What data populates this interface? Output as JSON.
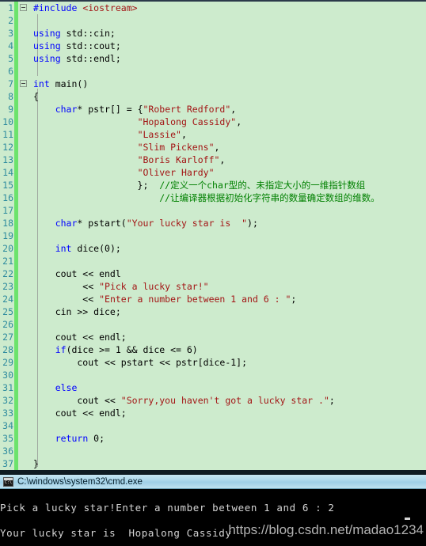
{
  "editor": {
    "name": "code-editor",
    "background_color": "#cdebcd",
    "gutter_strip_color": "#6ce36c",
    "lineno_color": "#2e8b9e",
    "colors": {
      "keyword": "#0000ff",
      "string": "#a31515",
      "comment": "#008000",
      "plain": "#000000"
    },
    "fold_markers": [
      1,
      7
    ],
    "lines": [
      {
        "no": "1",
        "tokens": [
          {
            "t": "#include ",
            "c": "kw"
          },
          {
            "t": "<iostream>",
            "c": "str"
          }
        ]
      },
      {
        "no": "2",
        "tokens": []
      },
      {
        "no": "3",
        "tokens": [
          {
            "t": "using",
            "c": "kw"
          },
          {
            "t": " std::cin;",
            "c": "plain"
          }
        ]
      },
      {
        "no": "4",
        "tokens": [
          {
            "t": "using",
            "c": "kw"
          },
          {
            "t": " std::cout;",
            "c": "plain"
          }
        ]
      },
      {
        "no": "5",
        "tokens": [
          {
            "t": "using",
            "c": "kw"
          },
          {
            "t": " std::endl;",
            "c": "plain"
          }
        ]
      },
      {
        "no": "6",
        "tokens": []
      },
      {
        "no": "7",
        "tokens": [
          {
            "t": "int",
            "c": "kw"
          },
          {
            "t": " main()",
            "c": "plain"
          }
        ]
      },
      {
        "no": "8",
        "tokens": [
          {
            "t": "{",
            "c": "plain"
          }
        ]
      },
      {
        "no": "9",
        "tokens": [
          {
            "t": "    ",
            "c": "plain"
          },
          {
            "t": "char",
            "c": "kw"
          },
          {
            "t": "* pstr[] = {",
            "c": "plain"
          },
          {
            "t": "\"Robert Redford\"",
            "c": "str"
          },
          {
            "t": ",",
            "c": "plain"
          }
        ]
      },
      {
        "no": "10",
        "tokens": [
          {
            "t": "                   ",
            "c": "plain"
          },
          {
            "t": "\"Hopalong Cassidy\"",
            "c": "str"
          },
          {
            "t": ",",
            "c": "plain"
          }
        ]
      },
      {
        "no": "11",
        "tokens": [
          {
            "t": "                   ",
            "c": "plain"
          },
          {
            "t": "\"Lassie\"",
            "c": "str"
          },
          {
            "t": ",",
            "c": "plain"
          }
        ]
      },
      {
        "no": "12",
        "tokens": [
          {
            "t": "                   ",
            "c": "plain"
          },
          {
            "t": "\"Slim Pickens\"",
            "c": "str"
          },
          {
            "t": ",",
            "c": "plain"
          }
        ]
      },
      {
        "no": "13",
        "tokens": [
          {
            "t": "                   ",
            "c": "plain"
          },
          {
            "t": "\"Boris Karloff\"",
            "c": "str"
          },
          {
            "t": ",",
            "c": "plain"
          }
        ]
      },
      {
        "no": "14",
        "tokens": [
          {
            "t": "                   ",
            "c": "plain"
          },
          {
            "t": "\"Oliver Hardy\"",
            "c": "str"
          }
        ]
      },
      {
        "no": "15",
        "tokens": [
          {
            "t": "                   };  ",
            "c": "plain"
          },
          {
            "t": "//定义一个char型的、未指定大小的一维指针数组",
            "c": "cmt"
          }
        ]
      },
      {
        "no": "16",
        "tokens": [
          {
            "t": "                       ",
            "c": "plain"
          },
          {
            "t": "//让编译器根据初始化字符串的数量确定数组的维数。",
            "c": "cmt"
          }
        ]
      },
      {
        "no": "17",
        "tokens": []
      },
      {
        "no": "18",
        "tokens": [
          {
            "t": "    ",
            "c": "plain"
          },
          {
            "t": "char",
            "c": "kw"
          },
          {
            "t": "* pstart(",
            "c": "plain"
          },
          {
            "t": "\"Your lucky star is  \"",
            "c": "str"
          },
          {
            "t": ");",
            "c": "plain"
          }
        ]
      },
      {
        "no": "19",
        "tokens": []
      },
      {
        "no": "20",
        "tokens": [
          {
            "t": "    ",
            "c": "plain"
          },
          {
            "t": "int",
            "c": "kw"
          },
          {
            "t": " dice(0);",
            "c": "plain"
          }
        ]
      },
      {
        "no": "21",
        "tokens": []
      },
      {
        "no": "22",
        "tokens": [
          {
            "t": "    cout << endl",
            "c": "plain"
          }
        ]
      },
      {
        "no": "23",
        "tokens": [
          {
            "t": "         << ",
            "c": "plain"
          },
          {
            "t": "\"Pick a lucky star!\"",
            "c": "str"
          }
        ]
      },
      {
        "no": "24",
        "tokens": [
          {
            "t": "         << ",
            "c": "plain"
          },
          {
            "t": "\"Enter a number between 1 and 6 : \"",
            "c": "str"
          },
          {
            "t": ";",
            "c": "plain"
          }
        ]
      },
      {
        "no": "25",
        "tokens": [
          {
            "t": "    cin >> dice;",
            "c": "plain"
          }
        ]
      },
      {
        "no": "26",
        "tokens": []
      },
      {
        "no": "27",
        "tokens": [
          {
            "t": "    cout << endl;",
            "c": "plain"
          }
        ]
      },
      {
        "no": "28",
        "tokens": [
          {
            "t": "    ",
            "c": "plain"
          },
          {
            "t": "if",
            "c": "kw"
          },
          {
            "t": "(dice >= 1 && dice <= 6)",
            "c": "plain"
          }
        ]
      },
      {
        "no": "29",
        "tokens": [
          {
            "t": "        cout << pstart << pstr[dice-1];",
            "c": "plain"
          }
        ]
      },
      {
        "no": "30",
        "tokens": []
      },
      {
        "no": "31",
        "tokens": [
          {
            "t": "    ",
            "c": "plain"
          },
          {
            "t": "else",
            "c": "kw"
          }
        ]
      },
      {
        "no": "32",
        "tokens": [
          {
            "t": "        cout << ",
            "c": "plain"
          },
          {
            "t": "\"Sorry,you haven't got a lucky star .\"",
            "c": "str"
          },
          {
            "t": ";",
            "c": "plain"
          }
        ]
      },
      {
        "no": "33",
        "tokens": [
          {
            "t": "    cout << endl;",
            "c": "plain"
          }
        ]
      },
      {
        "no": "34",
        "tokens": []
      },
      {
        "no": "35",
        "tokens": [
          {
            "t": "    ",
            "c": "plain"
          },
          {
            "t": "return",
            "c": "kw"
          },
          {
            "t": " 0;",
            "c": "plain"
          }
        ]
      },
      {
        "no": "36",
        "tokens": []
      },
      {
        "no": "37",
        "tokens": [
          {
            "t": "}",
            "c": "plain"
          }
        ]
      }
    ]
  },
  "console": {
    "title": "C:\\windows\\system32\\cmd.exe",
    "icon": "cmd-console-icon",
    "prompt_glyph": "C:\\",
    "background_color": "#000000",
    "text_color": "#d4d4d4",
    "lines": [
      "Pick a lucky star!Enter a number between 1 and 6 : 2",
      "Your lucky star is  Hopalong Cassidy"
    ]
  },
  "watermark": {
    "text": "https://blog.csdn.net/madao1234"
  }
}
